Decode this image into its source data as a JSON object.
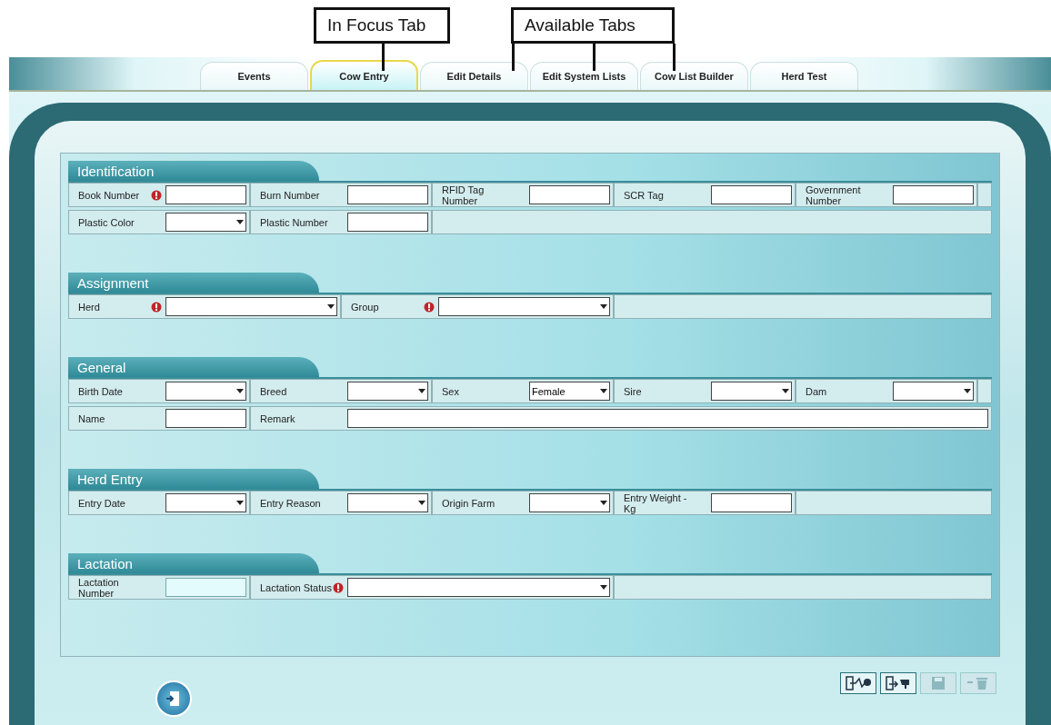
{
  "callouts": [
    {
      "label": "In Focus Tab"
    },
    {
      "label": "Available Tabs"
    }
  ],
  "tabs": [
    {
      "label": "Events",
      "selected": false
    },
    {
      "label": "Cow Entry",
      "selected": true
    },
    {
      "label": "Edit Details",
      "selected": false
    },
    {
      "label": "Edit System Lists",
      "selected": false
    },
    {
      "label": "Cow List Builder",
      "selected": false
    },
    {
      "label": "Herd Test",
      "selected": false
    }
  ],
  "sections": [
    {
      "title": "Identification",
      "rows": [
        [
          {
            "label": "Book Number",
            "kind": "text",
            "required": true,
            "disabled": false
          },
          {
            "label": "Burn Number",
            "kind": "text",
            "required": false,
            "disabled": false
          },
          {
            "label": "RFID Tag Number",
            "kind": "text",
            "required": false,
            "disabled": false
          },
          {
            "label": "SCR Tag",
            "kind": "text",
            "required": false,
            "disabled": false
          },
          {
            "label": "Government Number",
            "kind": "text",
            "required": false,
            "disabled": false
          }
        ],
        [
          {
            "label": "Plastic Color",
            "kind": "dropdown",
            "required": false,
            "disabled": false
          },
          {
            "label": "Plastic Number",
            "kind": "text",
            "required": false,
            "disabled": false
          }
        ]
      ]
    },
    {
      "title": "Assignment",
      "rows": [
        [
          {
            "label": "Herd",
            "kind": "wide-dropdown",
            "required": true,
            "disabled": false
          },
          {
            "label": "Group",
            "kind": "wide-dropdown",
            "required": true,
            "disabled": false
          }
        ]
      ]
    },
    {
      "title": "General",
      "rows": [
        [
          {
            "label": "Birth Date",
            "kind": "dropdown",
            "required": false,
            "disabled": false
          },
          {
            "label": "Breed",
            "kind": "dropdown",
            "required": false,
            "disabled": false
          },
          {
            "label": "Sex",
            "kind": "dropdown",
            "required": false,
            "disabled": false,
            "value": "Female"
          },
          {
            "label": "Sire",
            "kind": "dropdown",
            "required": false,
            "disabled": false
          },
          {
            "label": "Dam",
            "kind": "dropdown",
            "required": false,
            "disabled": false
          }
        ],
        [
          {
            "label": "Name",
            "kind": "text",
            "required": false,
            "disabled": false
          },
          {
            "label": "Remark",
            "kind": "long-text",
            "required": false,
            "disabled": false
          }
        ]
      ]
    },
    {
      "title": "Herd Entry",
      "rows": [
        [
          {
            "label": "Entry Date",
            "kind": "dropdown",
            "required": false,
            "disabled": false
          },
          {
            "label": "Entry Reason",
            "kind": "dropdown",
            "required": false,
            "disabled": false
          },
          {
            "label": "Origin Farm",
            "kind": "dropdown",
            "required": false,
            "disabled": false
          },
          {
            "label": "Entry Weight - Kg",
            "kind": "text",
            "required": false,
            "disabled": false
          }
        ]
      ]
    },
    {
      "title": "Lactation",
      "rows": [
        [
          {
            "label": "Lactation Number",
            "kind": "text",
            "required": false,
            "disabled": true
          },
          {
            "label": "Lactation Status",
            "kind": "long-dropdown",
            "required": true,
            "disabled": false
          }
        ]
      ]
    }
  ],
  "toolbar": [
    {
      "kind": "import",
      "disabled": false
    },
    {
      "kind": "transfer",
      "disabled": false
    },
    {
      "kind": "save",
      "disabled": true
    },
    {
      "kind": "delete",
      "disabled": true
    }
  ]
}
